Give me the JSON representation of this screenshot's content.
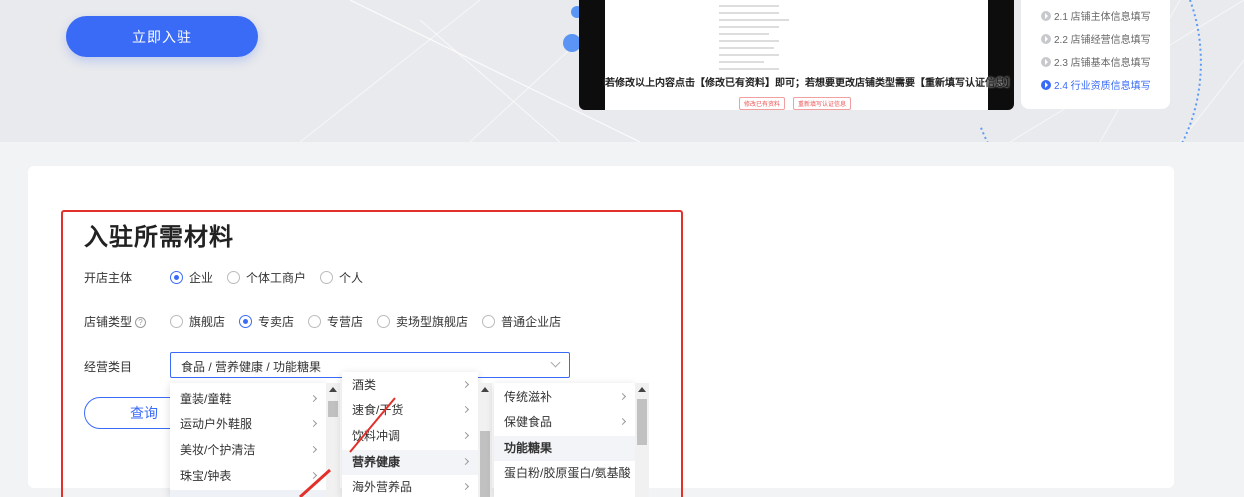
{
  "hero": {
    "apply_label": "立即入驻",
    "video_caption": "若修改以上内容点击【修改已有资料】即可；若想要更改店铺类型需要【重新填写认证信息】",
    "video_btn_1": "修改已有资料",
    "video_btn_2": "重新填写认证信息",
    "steps": [
      {
        "label": "2.1 店铺主体信息填写"
      },
      {
        "label": "2.2 店铺经营信息填写"
      },
      {
        "label": "2.3 店铺基本信息填写"
      },
      {
        "label": "2.4 行业资质信息填写"
      }
    ]
  },
  "materials": {
    "title": "入驻所需材料",
    "entity_label": "开店主体",
    "entity_options": [
      "企业",
      "个体工商户",
      "个人"
    ],
    "entity_selected": "企业",
    "shop_type_label": "店铺类型",
    "shop_type_help": "?",
    "shop_type_options": [
      "旗舰店",
      "专卖店",
      "专营店",
      "卖场型旗舰店",
      "普通企业店"
    ],
    "shop_type_selected": "专卖店",
    "category_label": "经营类目",
    "category_value": "食品 / 营养健康 / 功能糖果",
    "query_label": "查询"
  },
  "dropdown": {
    "col1": [
      "童装/童鞋",
      "运动户外鞋服",
      "美妆/个护清洁",
      "珠宝/钟表"
    ],
    "col2": [
      "酒类",
      "速食/干货",
      "饮料冲调",
      "营养健康",
      "海外营养品"
    ],
    "col2_selected": "营养健康",
    "col3": [
      "传统滋补",
      "保健食品",
      "功能糖果",
      "蛋白粉/胶原蛋白/氨基酸"
    ],
    "col3_selected": "功能糖果"
  }
}
